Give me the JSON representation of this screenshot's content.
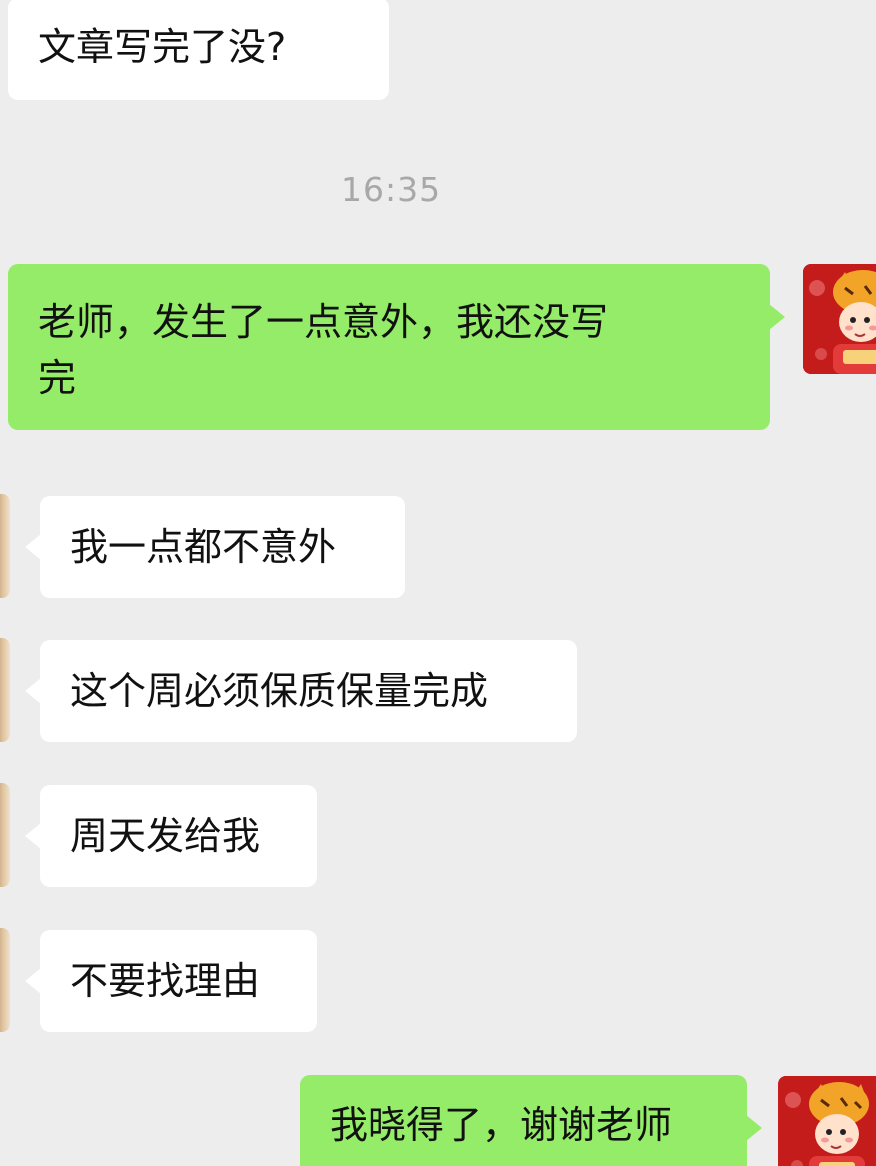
{
  "timestamp": "16:35",
  "messages": [
    {
      "sender": "other",
      "text": "文章写完了没?"
    },
    {
      "sender": "self",
      "line1": "老师，发生了一点意外，我还没写",
      "line2": "完"
    },
    {
      "sender": "other",
      "text": "我一点都不意外"
    },
    {
      "sender": "other",
      "text": "这个周必须保质保量完成"
    },
    {
      "sender": "other",
      "text": "周天发给我"
    },
    {
      "sender": "other",
      "text": "不要找理由"
    },
    {
      "sender": "self",
      "text": "我晓得了，谢谢老师"
    }
  ],
  "colors": {
    "background": "#ededed",
    "incoming_bubble": "#ffffff",
    "outgoing_bubble": "#95ec69",
    "timestamp_text": "#a8a8a8"
  },
  "avatars": {
    "self": "tiger-hat-child-avatar",
    "other": "contact-avatar"
  }
}
